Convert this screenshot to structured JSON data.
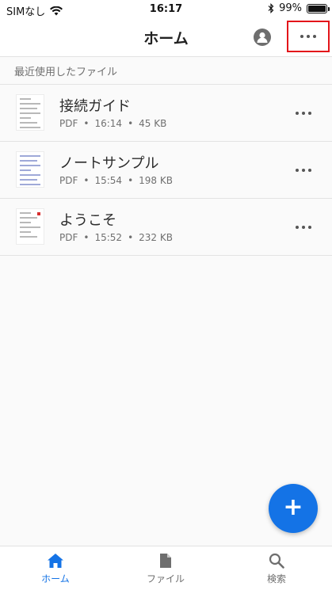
{
  "status_bar": {
    "carrier": "SIMなし",
    "time": "16:17",
    "battery": "99%",
    "battery_level": 0.99,
    "icons": [
      "wifi-icon",
      "bluetooth-icon",
      "battery-icon"
    ]
  },
  "header": {
    "title": "ホーム",
    "profile_icon": "profile-icon",
    "more_icon": "more-icon"
  },
  "recent": {
    "label": "最近使用したファイル",
    "files": [
      {
        "name": "接続ガイド",
        "type": "PDF",
        "time": "16:14",
        "size": "45 KB"
      },
      {
        "name": "ノートサンプル",
        "type": "PDF",
        "time": "15:54",
        "size": "198 KB"
      },
      {
        "name": "ようこそ",
        "type": "PDF",
        "time": "15:52",
        "size": "232 KB"
      }
    ]
  },
  "fab": {
    "symbol": "+",
    "icon": "plus-icon"
  },
  "tabs": [
    {
      "label": "ホーム",
      "icon": "home-icon",
      "active": true
    },
    {
      "label": "ファイル",
      "icon": "file-icon",
      "active": false
    },
    {
      "label": "検索",
      "icon": "search-icon",
      "active": false
    }
  ],
  "colors": {
    "accent": "#1473e6",
    "highlight_box": "#e3151a",
    "background": "#fafafa"
  }
}
